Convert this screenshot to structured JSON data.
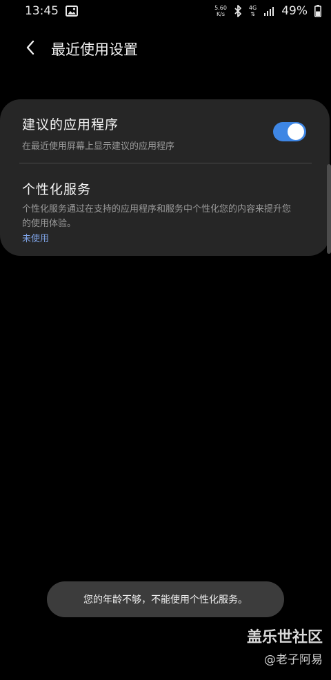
{
  "status_bar": {
    "time": "13:45",
    "net_speed_value": "5.60",
    "net_speed_unit": "K/s",
    "network_type": "4G",
    "battery_percent": "49%"
  },
  "header": {
    "title": "最近使用设置"
  },
  "settings": {
    "suggested_apps": {
      "title": "建议的应用程序",
      "subtitle": "在最近使用屏幕上显示建议的应用程序",
      "enabled": true
    },
    "personalization": {
      "title": "个性化服务",
      "description": "个性化服务通过在支持的应用程序和服务中个性化您的内容来提升您的使用体验。",
      "status": "未使用"
    }
  },
  "toast": {
    "message": "您的年龄不够，不能使用个性化服务。"
  },
  "watermark": {
    "brand": "盖乐世社区",
    "user": "@老子阿易"
  },
  "colors": {
    "background": "#000000",
    "card": "#262626",
    "accent": "#3e86e4",
    "link": "#7fa4e8",
    "toast_bg": "#3c3c3c"
  }
}
